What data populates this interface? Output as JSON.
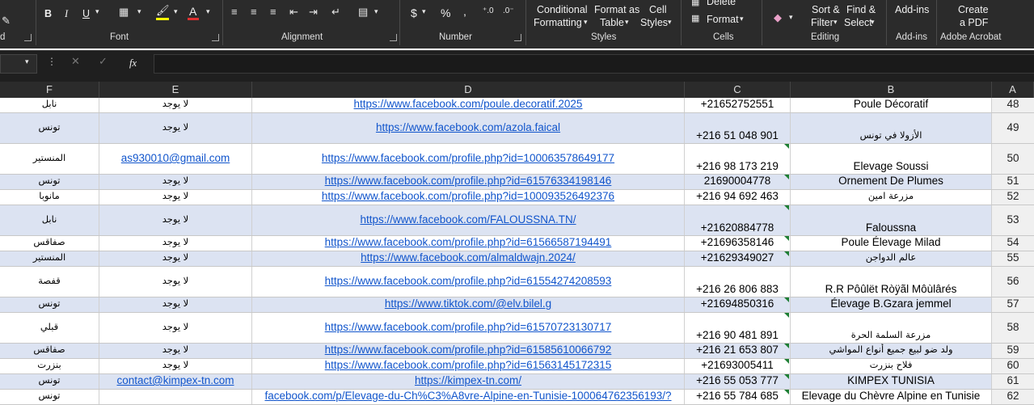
{
  "ribbon": {
    "groups": {
      "font": "Font",
      "alignment": "Alignment",
      "number": "Number",
      "styles": "Styles",
      "cells": "Cells",
      "editing": "Editing",
      "addins": "Add-ins",
      "acrobat": "Adobe Acrobat"
    },
    "buttons": {
      "conditional_1": "Conditional",
      "conditional_2": "Formatting",
      "format_as_1": "Format as",
      "format_as_2": "Table",
      "cell_styles_1": "Cell",
      "cell_styles_2": "Styles",
      "delete": "Delete",
      "format": "Format",
      "sort_1": "Sort &",
      "sort_2": "Filter",
      "find_1": "Find &",
      "find_2": "Select",
      "addins": "Add-ins",
      "create_1": "Create",
      "create_2": "a PDF",
      "bold": "B",
      "italic": "I",
      "underline": "U",
      "currency": "$",
      "percent": "%",
      "comma": ",",
      "fx": "fx"
    }
  },
  "columns": [
    "F",
    "E",
    "D",
    "C",
    "B",
    "A"
  ],
  "rows": [
    {
      "num": "48",
      "F": "نابل",
      "E": "لا يوجد",
      "D": "https://www.facebook.com/poule.decoratif.2025",
      "C": "+21652752551",
      "B": "Poule Décoratif"
    },
    {
      "num": "49",
      "F": "تونس",
      "E": "لا يوجد",
      "D": "https://www.facebook.com/azola.faical",
      "C": "+216 51 048 901",
      "B": "الأزولا في تونس"
    },
    {
      "num": "50",
      "F": "المنستير",
      "E": "as930010@gmail.com",
      "D": "https://www.facebook.com/profile.php?id=100063578649177",
      "C": "+216 98 173 219",
      "B": "Elevage Soussi"
    },
    {
      "num": "51",
      "F": "تونس",
      "E": "لا يوجد",
      "D": "https://www.facebook.com/profile.php?id=61576334198146",
      "C": "21690004778",
      "B": "Ornement De Plumes"
    },
    {
      "num": "52",
      "F": "مانوبا",
      "E": "لا يوجد",
      "D": "https://www.facebook.com/profile.php?id=100093526492376",
      "C": "+216 94 692 463",
      "B": "مزرعة امين"
    },
    {
      "num": "53",
      "F": "نابل",
      "E": "لا يوجد",
      "D": "https://www.facebook.com/FALOUSSNA.TN/",
      "C": "+21620884778",
      "B": "Faloussna"
    },
    {
      "num": "54",
      "F": "صفاقس",
      "E": "لا يوجد",
      "D": "https://www.facebook.com/profile.php?id=61566587194491",
      "C": "+21696358146",
      "B": "Poule Élevage Milad"
    },
    {
      "num": "55",
      "F": "المنستير",
      "E": "لا يوجد",
      "D": "https://www.facebook.com/almaldwajn.2024/",
      "C": "+21629349027",
      "B": "عالم الدواجن"
    },
    {
      "num": "56",
      "F": "قفصة",
      "E": "لا يوجد",
      "D": "https://www.facebook.com/profile.php?id=61554274208593",
      "C": "+216 26 806 883",
      "B": "R.R Pôûlët Ròÿãl Môùlârés"
    },
    {
      "num": "57",
      "F": "تونس",
      "E": "لا يوجد",
      "D": "https://www.tiktok.com/@elv.bilel.g",
      "C": "+21694850316",
      "B": "Élevage B.Gzara jemmel"
    },
    {
      "num": "58",
      "F": "قبلي",
      "E": "لا يوجد",
      "D": "https://www.facebook.com/profile.php?id=61570723130717",
      "C": "+216 90 481 891",
      "B": "مزرعة السلمة الحرة"
    },
    {
      "num": "59",
      "F": "صفاقس",
      "E": "لا يوجد",
      "D": "https://www.facebook.com/profile.php?id=61585610066792",
      "C": "+216 21 653 807",
      "B": "ولد ضو لبيع جميع أنواع المواشي"
    },
    {
      "num": "60",
      "F": "بنزرت",
      "E": "لا يوجد",
      "D": "https://www.facebook.com/profile.php?id=61563145172315",
      "C": "+21693005411",
      "B": "فلاح بنزرت"
    },
    {
      "num": "61",
      "F": "تونس",
      "E": "contact@kimpex-tn.com",
      "D": "https://kimpex-tn.com/",
      "C": "+216 55 053 777",
      "B": "KIMPEX TUNISIA"
    },
    {
      "num": "62",
      "F": "تونس",
      "E": "",
      "D": "facebook.com/p/Elevage-du-Ch%C3%A8vre-Alpine-en-Tunisie-100064762356193/?",
      "C": "+216 55 784 685",
      "B": "Elevage du Chèvre Alpine en Tunisie"
    }
  ]
}
